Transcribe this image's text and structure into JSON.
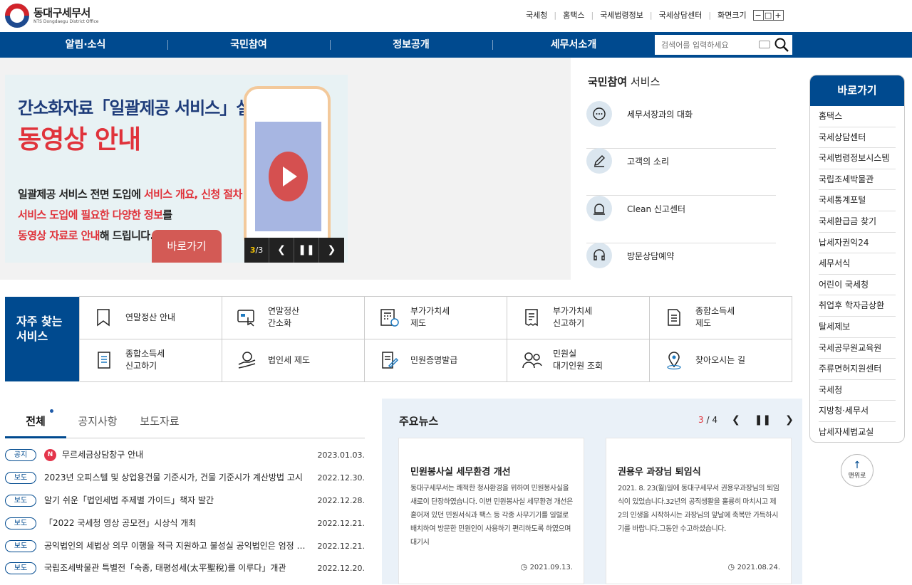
{
  "header": {
    "office_name": "동대구세무서",
    "office_name_en": "NTS Dongdaegu District Office",
    "top_links": [
      "국세청",
      "홈택스",
      "국세법령정보",
      "국세상담센터"
    ],
    "screen_size_label": "화면크기",
    "zoom_minus": "−",
    "zoom_reset": "□",
    "zoom_plus": "+"
  },
  "nav": {
    "items": [
      "알림·소식",
      "국민참여",
      "정보공개",
      "세무서소개"
    ],
    "search_placeholder": "검색어를 입력하세요"
  },
  "banner": {
    "title_line1": "간소화자료「일괄제공 서비스」설명",
    "title_line2": "동영상 안내",
    "desc_line1_a": "일괄제공 서비스 전면 도입에 ",
    "desc_line1_b": "서비스 개요, 신청 절차 등",
    "desc_line2_a": "서비스 도입에 필요한 다양한 정보",
    "desc_line2_b": "를",
    "desc_line3_a": "동영상 자료로 안내",
    "desc_line3_b": "해 드립니다.",
    "button_label": "바로가기",
    "counter_current": "3",
    "counter_total": "3"
  },
  "participation": {
    "title_bold": "국민참여",
    "title_rest": " 서비스",
    "items": [
      "세무서장과의 대화",
      "고객의 소리",
      "Clean 신고센터",
      "방문상담예약"
    ]
  },
  "quick_links": {
    "title": "바로가기",
    "items": [
      "홈택스",
      "국세상담센터",
      "국세법령정보시스템",
      "국립조세박물관",
      "국세통계포털",
      "국세환급금 찾기",
      "납세자권익24",
      "세무서식",
      "어린이 국세청",
      "취업후 학자금상환",
      "탈세제보",
      "국세공무원교육원",
      "주류면허지원센터",
      "국세청",
      "지방청·세무서",
      "납세자세법교실"
    ],
    "top_button": "맨위로"
  },
  "frequent": {
    "title_line1": "자주 찾는",
    "title_line2": "서비스",
    "items": [
      {
        "line1": "연말정산 안내",
        "line2": ""
      },
      {
        "line1": "연말정산",
        "line2": "간소화"
      },
      {
        "line1": "부가가치세",
        "line2": "제도"
      },
      {
        "line1": "부가가치세",
        "line2": "신고하기"
      },
      {
        "line1": "종합소득세",
        "line2": "제도"
      },
      {
        "line1": "종합소득세",
        "line2": "신고하기"
      },
      {
        "line1": "법인세 제도",
        "line2": ""
      },
      {
        "line1": "민원증명발급",
        "line2": ""
      },
      {
        "line1": "민원실",
        "line2": "대기인원 조회"
      },
      {
        "line1": "찾아오시는 길",
        "line2": ""
      }
    ]
  },
  "board": {
    "tabs": [
      "전체",
      "공지사항",
      "보도자료"
    ],
    "new_badge": "N",
    "rows": [
      {
        "type": "공지",
        "is_new": true,
        "title": "무르세금상담창구 안내",
        "date": "2023.01.03."
      },
      {
        "type": "보도",
        "is_new": false,
        "title": "2023년 오피스텔 및 상업용건물 기준시가, 건물 기준시가 계산방법 고시",
        "date": "2022.12.30."
      },
      {
        "type": "보도",
        "is_new": false,
        "title": "알기 쉬운「법인세법 주제별 가이드」책자 발간",
        "date": "2022.12.28."
      },
      {
        "type": "보도",
        "is_new": false,
        "title": "「2022 국세청 영상 공모전」시상식 개최",
        "date": "2022.12.21."
      },
      {
        "type": "보도",
        "is_new": false,
        "title": "공익법인의 세법상 의무 이행을 적극 지원하고 불성실 공익법인은 엄정 대응",
        "date": "2022.12.21."
      },
      {
        "type": "보도",
        "is_new": false,
        "title": "국립조세박물관 특별전「숙종, 태평성세(太平聖稅)를 이루다」개관",
        "date": "2022.12.20."
      }
    ]
  },
  "news": {
    "title": "주요뉴스",
    "current": "3",
    "total": "4",
    "cards": [
      {
        "title": "민원봉사실 세무환경 개선",
        "body": "동대구세무서는 쾌적한 청사환경을 위하여 민원봉사실을 새로이 단장하였습니다. 이번 민원봉사실 세무환경 개선은 흩어져 있던 민원서식과 팩스 등 각종 사무기기를 일렬로 배치하여 방문한 민원인이 사용하기 편리하도록 하였으며 대기시",
        "date": "2021.09.13."
      },
      {
        "title": "권용우 과장님 퇴임식",
        "body": "2021. 8. 23(월)일에 동대구세무서 권용우과장님의 퇴임식이 있었습니다.32년의 공직생활을 훌륭히 마치시고 제2의 인생을 시작하시는 과장님의 앞날에 축복만 가득하시기를 바랍니다.그동안 수고하셨습니다.",
        "date": "2021.08.24."
      }
    ]
  },
  "colors": {
    "primary": "#004a8f",
    "accent_red": "#e0333b"
  }
}
